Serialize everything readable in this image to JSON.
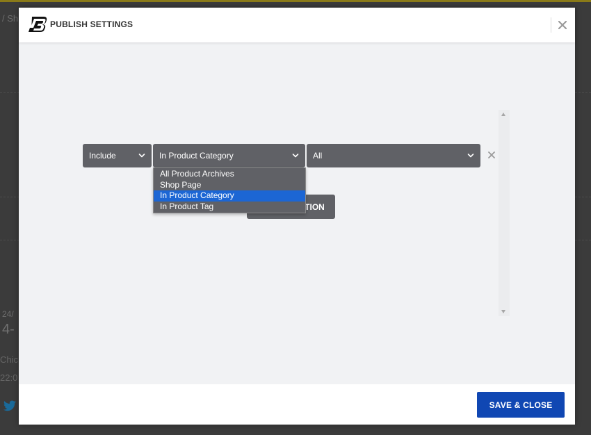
{
  "background": {
    "breadcrumb": "/ Sh",
    "date": "24/",
    "title": "4-",
    "snippet_1": "Chic",
    "snippet_2": "22:0"
  },
  "modal": {
    "title": "PUBLISH SETTINGS",
    "close_icon": "close-icon",
    "logo_icon": "b-logo-icon"
  },
  "condition": {
    "include_value": "Include",
    "type_value": "In Product Category",
    "value_value": "All"
  },
  "dropdown": {
    "options": [
      "All Product Archives",
      "Shop Page",
      "In Product Category",
      "In Product Tag"
    ],
    "selected_index": 2
  },
  "add_condition_label": "ADD CONDITION",
  "footer": {
    "save_label": "SAVE & CLOSE"
  },
  "colors": {
    "primary": "#1047b3",
    "select_bg": "#606166",
    "highlight": "#1c66d4",
    "body_bg": "#f1f2f4"
  }
}
